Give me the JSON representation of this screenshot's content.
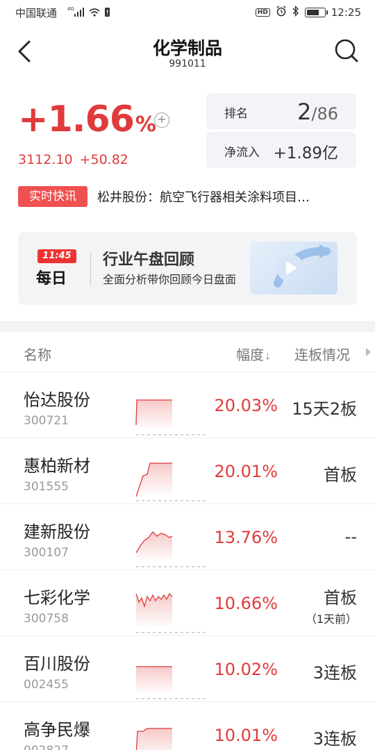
{
  "status_bar": {
    "carrier": "中国联通",
    "network": "4G",
    "time": "12:25",
    "hd": "HD"
  },
  "header": {
    "title": "化学制品",
    "code": "991011"
  },
  "quote": {
    "change_pct": "+1.66",
    "pct_unit": "%",
    "price": "3112.10",
    "change": "+50.82",
    "rank_label": "排名",
    "rank": "2",
    "rank_total": "/86",
    "inflow_label": "净流入",
    "inflow": "+1.89亿"
  },
  "news": {
    "tag": "实时快讯",
    "text": "松井股份：航空飞行器相关涂料项目…"
  },
  "banner": {
    "time": "11:45",
    "day": "每日",
    "title": "行业午盘回顾",
    "subtitle": "全面分析带你回顾今日盘面"
  },
  "list": {
    "col_name": "名称",
    "col_change": "幅度",
    "col_change_arrow": "↓",
    "col_board": "连板情况",
    "rows": [
      {
        "name": "怡达股份",
        "code": "300721",
        "change": "20.03%",
        "board": "15天2板",
        "board_sub": ""
      },
      {
        "name": "惠柏新材",
        "code": "301555",
        "change": "20.01%",
        "board": "首板",
        "board_sub": ""
      },
      {
        "name": "建新股份",
        "code": "300107",
        "change": "13.76%",
        "board": "--",
        "board_sub": ""
      },
      {
        "name": "七彩化学",
        "code": "300758",
        "change": "10.66%",
        "board": "首板",
        "board_sub": "（1天前）"
      },
      {
        "name": "百川股份",
        "code": "002455",
        "change": "10.02%",
        "board": "3连板",
        "board_sub": ""
      },
      {
        "name": "高争民爆",
        "code": "002827",
        "change": "10.01%",
        "board": "3连板",
        "board_sub": ""
      }
    ]
  },
  "colors": {
    "up": "#e03a3a",
    "tag_bg": "#ef5050"
  }
}
